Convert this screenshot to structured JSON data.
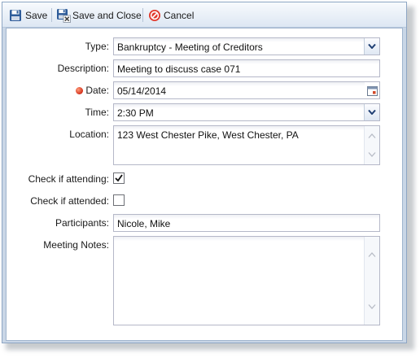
{
  "toolbar": {
    "save_label": "Save",
    "save_close_label": "Save and Close",
    "cancel_label": "Cancel"
  },
  "form": {
    "type": {
      "label": "Type:",
      "value": "Bankruptcy - Meeting of Creditors"
    },
    "description": {
      "label": "Description:",
      "value": "Meeting to discuss case 071"
    },
    "date": {
      "label": "Date:",
      "value": "05/14/2014"
    },
    "time": {
      "label": "Time:",
      "value": "2:30 PM"
    },
    "location": {
      "label": "Location:",
      "value": "123 West Chester Pike, West Chester, PA"
    },
    "attending": {
      "label": "Check if attending:",
      "checked": true
    },
    "attended": {
      "label": "Check if attended:",
      "checked": false
    },
    "participants": {
      "label": "Participants:",
      "value": "Nicole, Mike"
    },
    "notes": {
      "label": "Meeting Notes:",
      "value": ""
    }
  },
  "colors": {
    "required_dot": "#d3301b",
    "cancel_icon": "#e23b2e",
    "save_icon": "#2e5c9a"
  },
  "icons": [
    "save-icon",
    "save-close-icon",
    "cancel-icon",
    "dropdown-arrow-icon",
    "calendar-icon",
    "checkmark-icon",
    "scroll-up-icon",
    "scroll-down-icon",
    "required-dot-icon"
  ]
}
